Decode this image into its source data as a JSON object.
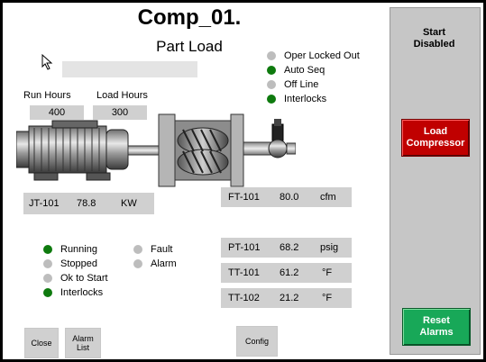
{
  "header": {
    "title": "Comp_01.",
    "subtitle": "Part Load"
  },
  "hours": {
    "run_label": "Run Hours",
    "run_value": "400",
    "load_label": "Load Hours",
    "load_value": "300"
  },
  "status_top": [
    {
      "label": "Oper Locked Out",
      "color": "grey"
    },
    {
      "label": "Auto Seq",
      "color": "green"
    },
    {
      "label": "Off Line",
      "color": "grey"
    },
    {
      "label": "Interlocks",
      "color": "green"
    }
  ],
  "power": {
    "tag": "JT-101",
    "value": "78.8",
    "unit": "KW"
  },
  "readings": [
    {
      "tag": "FT-101",
      "value": "80.0",
      "unit": "cfm"
    },
    {
      "tag": "PT-101",
      "value": "68.2",
      "unit": "psig"
    },
    {
      "tag": "TT-101",
      "value": "61.2",
      "unit": "°F"
    },
    {
      "tag": "TT-102",
      "value": "21.2",
      "unit": "°F"
    }
  ],
  "status_left": [
    {
      "label": "Running",
      "color": "green"
    },
    {
      "label": "Stopped",
      "color": "grey"
    },
    {
      "label": "Ok to Start",
      "color": "grey"
    },
    {
      "label": "Interlocks",
      "color": "green"
    }
  ],
  "status_right": [
    {
      "label": "Fault",
      "color": "grey"
    },
    {
      "label": "Alarm",
      "color": "grey"
    }
  ],
  "buttons": {
    "close": "Close",
    "alarm_list_1": "Alarm",
    "alarm_list_2": "List",
    "config": "Config"
  },
  "panel": {
    "start_1": "Start",
    "start_2": "Disabled",
    "load_1": "Load",
    "load_2": "Compressor",
    "reset_1": "Reset",
    "reset_2": "Alarms"
  },
  "colors": {
    "green": "#0e7a0e",
    "grey": "#bdbdbd",
    "load": "#c00000",
    "reset": "#18a858",
    "panel": "#c6c6c6"
  }
}
